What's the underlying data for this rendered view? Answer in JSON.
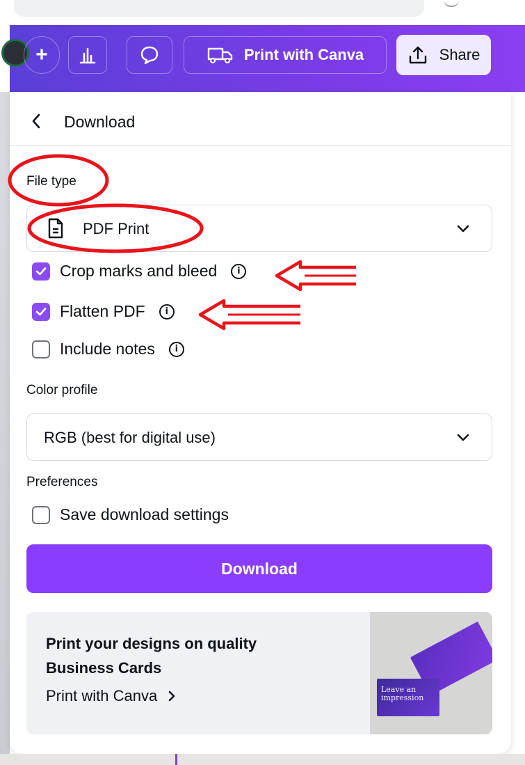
{
  "toolbar": {
    "plus_label": "+",
    "print_label": "Print with Canva",
    "share_label": "Share"
  },
  "panel": {
    "back_glyph": "‹",
    "title": "Download",
    "file_type_label": "File type",
    "file_type_value": "PDF Print",
    "options": [
      {
        "label": "Crop marks and bleed",
        "checked": true,
        "has_info": true
      },
      {
        "label": "Flatten PDF",
        "checked": true,
        "has_info": true
      },
      {
        "label": "Include notes",
        "checked": false,
        "has_info": true
      }
    ],
    "color_profile_label": "Color profile",
    "color_profile_value": "RGB (best for digital use)",
    "preferences_label": "Preferences",
    "save_settings_label": "Save download settings",
    "save_settings_checked": false,
    "download_label": "Download"
  },
  "promo": {
    "title": "Print your designs on quality Business Cards",
    "link_label": "Print with Canva",
    "card_text": "Leave an impression"
  },
  "colors": {
    "accent": "#8b3dff",
    "checkbox": "#8a4cf0",
    "toolbar_start": "#5b3fd8",
    "toolbar_end": "#8a3ff0",
    "annotation": "#e8141b"
  },
  "icons": {
    "chart": "bar-chart-icon",
    "comment": "comment-icon",
    "truck": "truck-icon",
    "share": "share-upload-icon",
    "file": "document-icon",
    "info": "info-icon",
    "chevron": "chevron-down-icon"
  }
}
